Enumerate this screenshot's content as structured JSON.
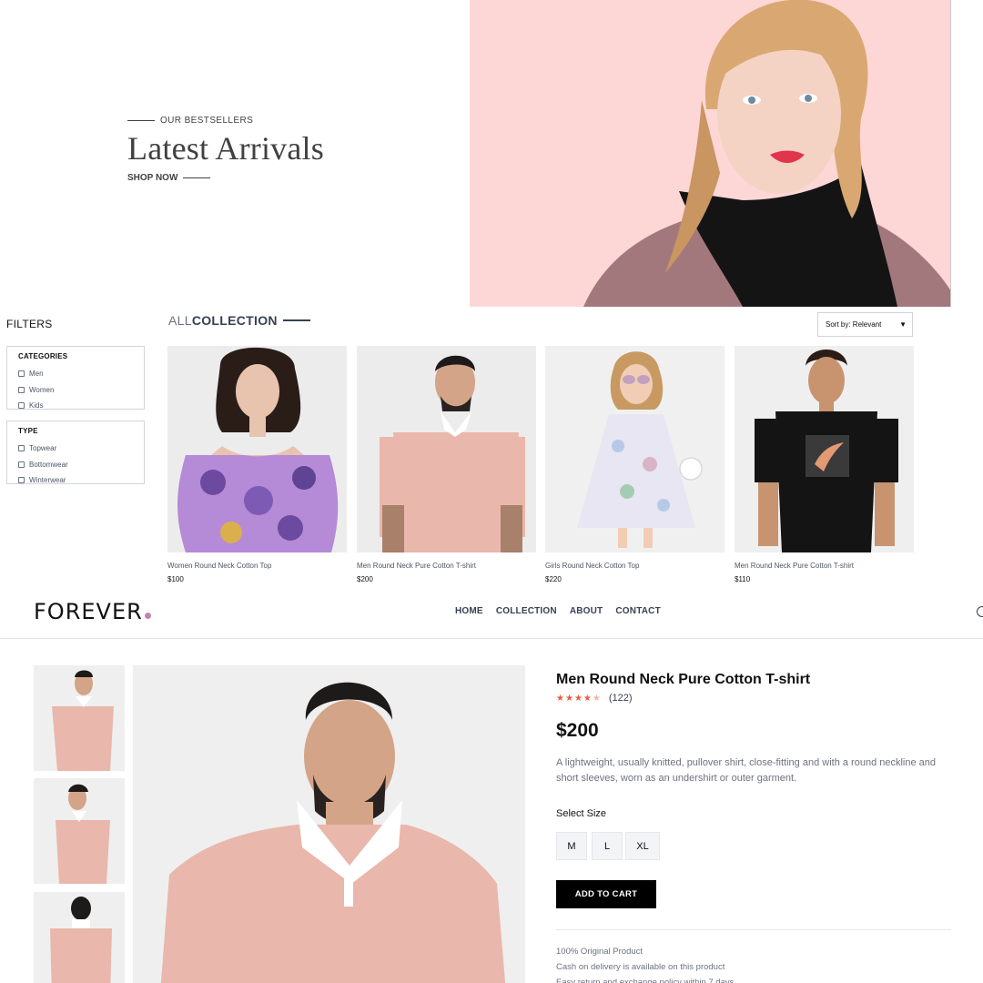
{
  "hero": {
    "eyebrow": "OUR BESTSELLERS",
    "title": "Latest Arrivals",
    "cta": "SHOP NOW",
    "bg_color": "#fcd7d6"
  },
  "filters": {
    "title": "FILTERS",
    "categories": {
      "heading": "CATEGORIES",
      "options": [
        "Men",
        "Women",
        "Kids"
      ]
    },
    "type": {
      "heading": "TYPE",
      "options": [
        "Topwear",
        "Bottomwear",
        "Winterwear"
      ]
    }
  },
  "collection": {
    "title_part1": "ALL",
    "title_part2": "COLLECTION",
    "sort": "Sort by: Relevant",
    "products": [
      {
        "name": "Women Round Neck Cotton Top",
        "price": "$100"
      },
      {
        "name": "Men Round Neck Pure Cotton T-shirt",
        "price": "$200"
      },
      {
        "name": "Girls Round Neck Cotton Top",
        "price": "$220"
      },
      {
        "name": "Men Round Neck Pure Cotton T-shirt",
        "price": "$110"
      }
    ]
  },
  "nav": {
    "logo": "FOREVER",
    "links": [
      "HOME",
      "COLLECTION",
      "ABOUT",
      "CONTACT"
    ],
    "accent": "#c586a5"
  },
  "product": {
    "title": "Men Round Neck Pure Cotton T-shirt",
    "rating": 4,
    "rating_max": 5,
    "reviews": "(122)",
    "price": "$200",
    "description": "A lightweight, usually knitted, pullover shirt, close-fitting and with a round neckline and short sleeves, worn as an undershirt or outer garment.",
    "size_label": "Select Size",
    "sizes": [
      "M",
      "L",
      "XL"
    ],
    "add_to_cart": "ADD TO CART",
    "policies": [
      "100% Original Product",
      "Cash on delivery is available on this product",
      "Easy return and exchange policy within 7 days."
    ]
  }
}
